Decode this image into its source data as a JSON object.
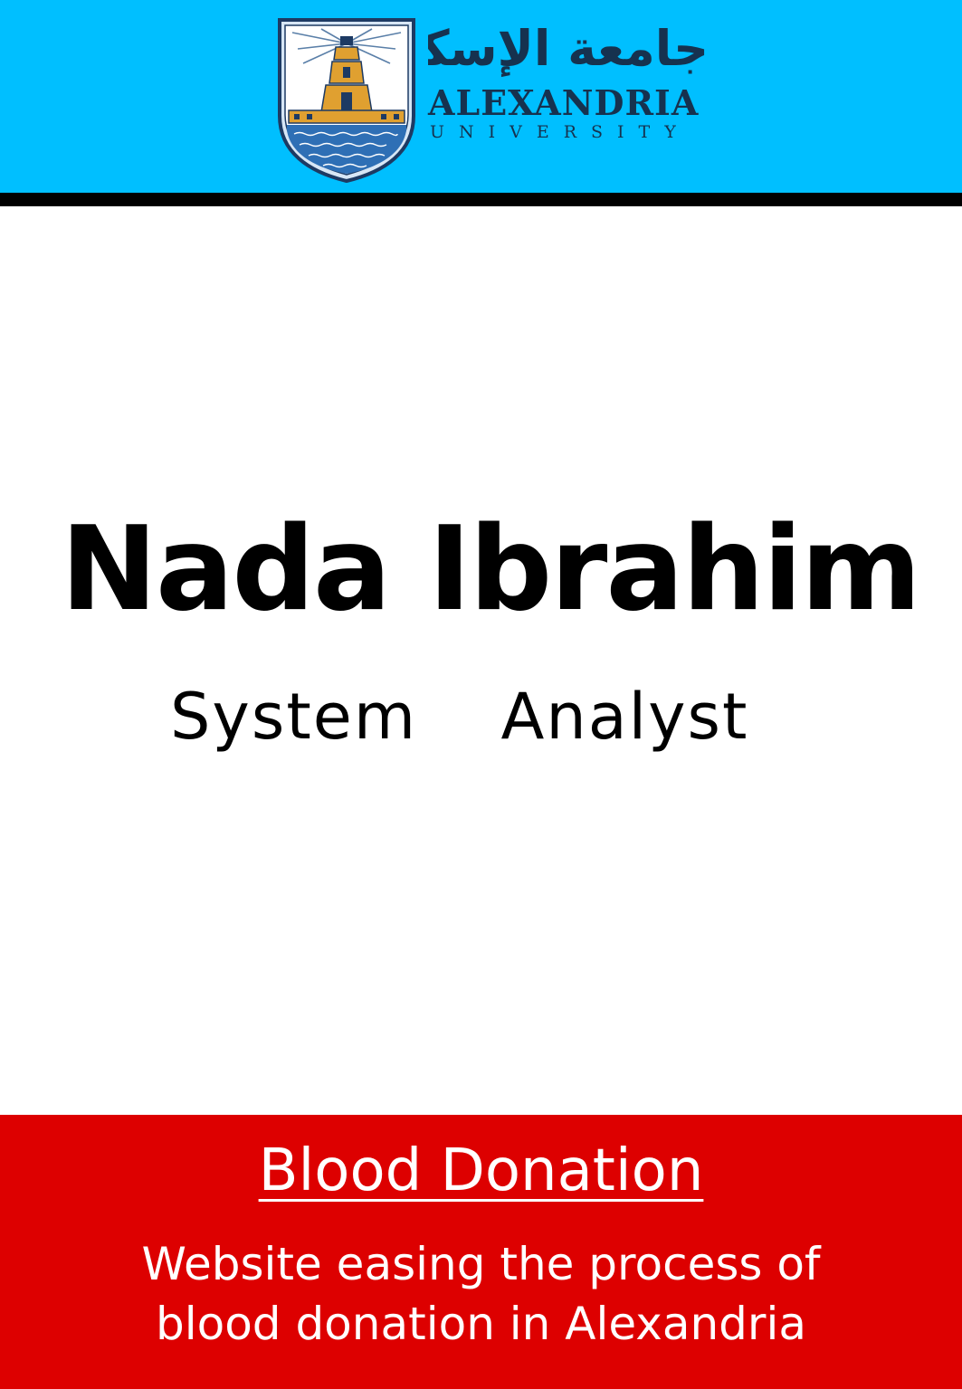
{
  "header": {
    "background_color": "#00BFFF",
    "rule_color": "#000000",
    "logo": {
      "icon": "lighthouse-shield-icon",
      "arabic_name": "جامعة الإسكندرية",
      "name": "ALEXANDRIA",
      "subtitle": "UNIVERSITY"
    }
  },
  "person": {
    "name": "Nada Ibrahim",
    "role": "System  Analyst"
  },
  "footer": {
    "background_color": "#DD0000",
    "project_title": "Blood Donation",
    "description_line1": "Website easing the process of",
    "description_line2": "blood donation in Alexandria"
  }
}
